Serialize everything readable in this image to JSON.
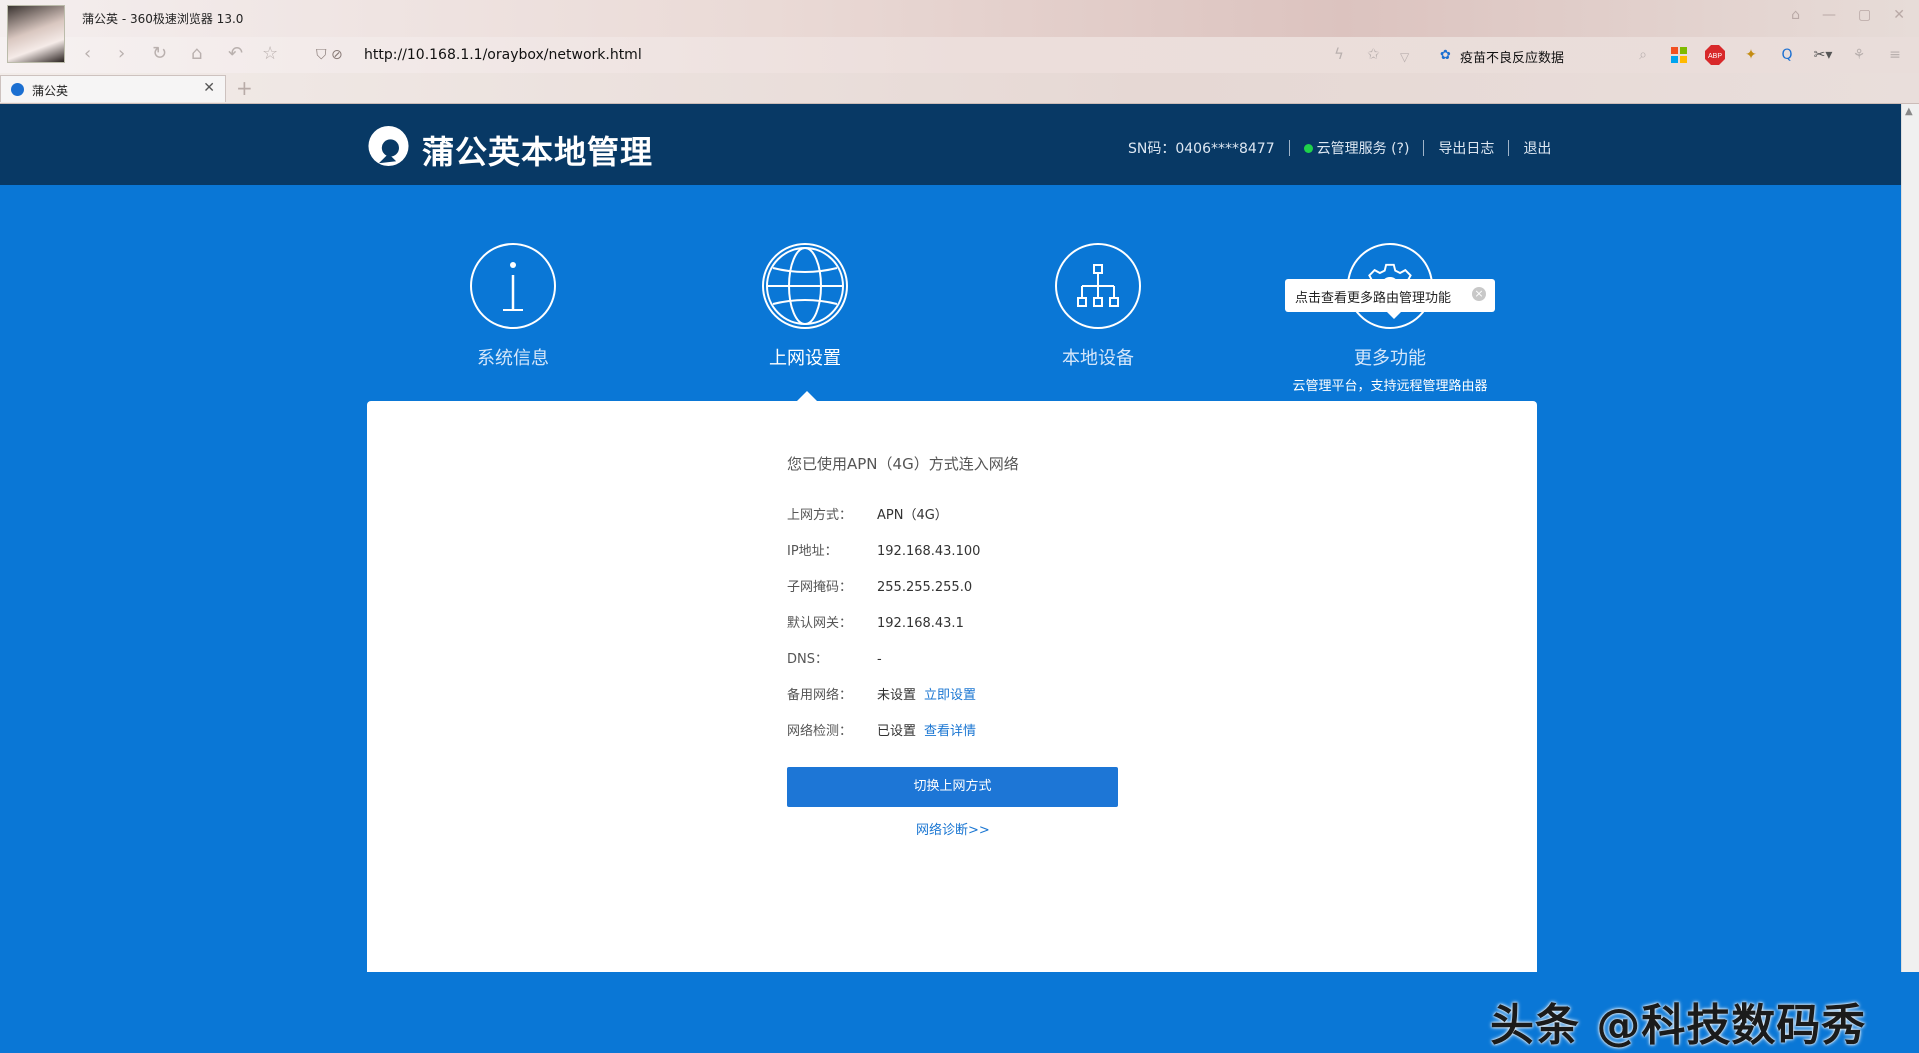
{
  "browser": {
    "window_title": "蒲公英 - 360极速浏览器 13.0",
    "url": "http://10.168.1.1/oraybox/network.html",
    "news_text": "疫苗不良反应数据",
    "tab_title": "蒲公英",
    "toolbar_icons": [
      "back-icon",
      "forward-icon",
      "refresh-icon",
      "home-icon",
      "undo-icon",
      "star-icon"
    ],
    "right_icons": [
      "lightning-icon",
      "favorite-icon",
      "dropdown-icon",
      "search-icon",
      "apps-icon",
      "abp-icon",
      "extension-icon",
      "sync-icon",
      "scissors-icon",
      "settings-icon",
      "menu-icon"
    ],
    "abp_label": "ABP"
  },
  "header": {
    "brand": "蒲公英本地管理",
    "sn": "SN码：0406****8477",
    "cloud_service": "云管理服务 (?)",
    "export_log": "导出日志",
    "logout": "退出"
  },
  "nav": {
    "items": [
      {
        "label": "系统信息",
        "icon": "info-icon"
      },
      {
        "label": "上网设置",
        "icon": "globe-icon"
      },
      {
        "label": "本地设备",
        "icon": "network-tree-icon"
      },
      {
        "label": "更多功能",
        "icon": "gear-icon",
        "sub": "云管理平台，支持远程管理路由器"
      }
    ],
    "tooltip": "点击查看更多路由管理功能"
  },
  "card": {
    "heading": "您已使用APN（4G）方式连入网络",
    "rows": [
      {
        "key": "上网方式：",
        "value": "APN（4G）"
      },
      {
        "key": "IP地址：",
        "value": "192.168.43.100"
      },
      {
        "key": "子网掩码：",
        "value": "255.255.255.0"
      },
      {
        "key": "默认网关：",
        "value": "192.168.43.1"
      },
      {
        "key": "DNS：",
        "value": "-"
      },
      {
        "key": "备用网络：",
        "value": "未设置",
        "link": "立即设置"
      },
      {
        "key": "网络检测：",
        "value": "已设置",
        "link": "查看详情"
      }
    ],
    "switch_button": "切换上网方式",
    "diagnose_link": "网络诊断>>"
  },
  "watermark": "头条 @科技数码秀"
}
